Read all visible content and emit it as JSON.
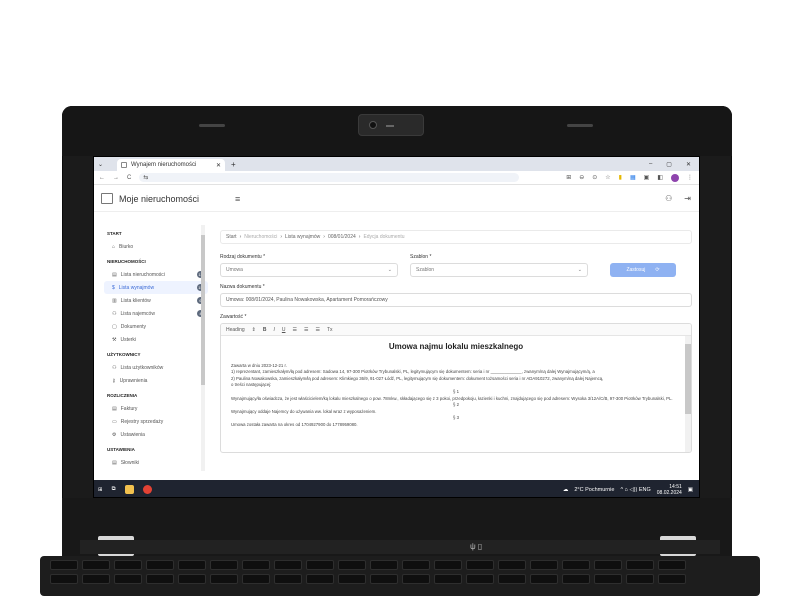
{
  "browser": {
    "tab_title": "Wynajem nieruchomości",
    "tab_close": "✕",
    "new_tab": "+",
    "window_controls": [
      "–",
      "▢",
      "✕"
    ],
    "nav": [
      "←",
      "→",
      "C",
      "⇆"
    ]
  },
  "app": {
    "title": "Moje nieruchomości",
    "menu_icon": "≡",
    "user_icon": "person-icon",
    "logout_icon": "logout-icon"
  },
  "sidebar": {
    "sections": [
      {
        "title": "START",
        "items": [
          {
            "label": "Biurko"
          }
        ]
      },
      {
        "title": "NIERUCHOMOŚCI",
        "items": [
          {
            "label": "Lista nieruchomości",
            "badge": "11"
          },
          {
            "label": "Lista wynajmów",
            "badge": "15",
            "active": true
          },
          {
            "label": "Lista klientów",
            "badge": "6"
          },
          {
            "label": "Lista najemców",
            "badge": "4"
          },
          {
            "label": "Dokumenty"
          },
          {
            "label": "Usterki"
          }
        ]
      },
      {
        "title": "UŻYTKOWNICY",
        "items": [
          {
            "label": "Lista użytkowników"
          },
          {
            "label": "Uprawnienia"
          }
        ]
      },
      {
        "title": "ROZLICZENIA",
        "items": [
          {
            "label": "Faktury"
          },
          {
            "label": "Rejestry sprzedaży"
          },
          {
            "label": "Ustawienia"
          }
        ]
      },
      {
        "title": "USTAWIENIA",
        "items": [
          {
            "label": "Słowniki"
          }
        ]
      }
    ]
  },
  "breadcrumb": [
    "Start",
    "Nieruchomości",
    "Lista wynajmów",
    "008/01/2024",
    "Edycja dokumentu"
  ],
  "form": {
    "doc_type_label": "Rodzaj dokumentu *",
    "doc_type_value": "Umowa",
    "template_label": "Szablon *",
    "template_value": "Szablon",
    "apply_button": "Zastosuj",
    "name_label": "Nazwa dokumentu *",
    "name_value": "Umowa: 008/01/2024, Paulina Nowakowska, Apartament Pomorańczowy",
    "content_label": "Zawartość *",
    "toolbar_heading": "Heading",
    "toolbar_buttons": [
      "B",
      "I",
      "U",
      "☰",
      "☰",
      "☰",
      "Tx"
    ]
  },
  "document": {
    "heading": "Umowa najmu lokalu mieszkalnego",
    "lines": [
      "Zawarta w dniu 2023-12-21 r.",
      "1) reprezentant, zamieszkałym/łą pod adresem: Sadowa 14, 97-300 Piotrków Trybunalski, PL, legitymującym się dokumentem: seria i nr _____________, zwanym/ną dalej Wynajmującym/ą, a",
      "2) Paulina Nowakowska, zamieszkałym/łą pod adresem: Klimkiego 36/9, 91-027 Łódź, PL, legitymującym się dokumentem: dokument tożsamości seria i nr ADA910272, zwanym/ną dalej Najemcą,",
      "o treści następującej:",
      "§ 1",
      "Wynajmujący/ła oświadcza, że jest właścicielem/ką lokalu mieszkalnego o pow. 78mkw., składającego się z 3 pokoi, przedpokoju, łazienki i kuchni, znajdującego się pod adresem: Wysoka 3/12A/C/B, 97-300 Piotrków Trybunalski, PL.",
      "§ 2",
      "Wynajmujący oddaje Najemcy do używania ww. lokal wraz z wyposażeniem.",
      "§ 3",
      "Umowa została zawarta na okres od 1704927900 do 1778959080."
    ]
  },
  "taskbar": {
    "weather": "2°C  Pochmurnie",
    "time": "14:51",
    "date": "08.02.2024",
    "tray": "^  ⌂  ◁))  ENG"
  },
  "colors": {
    "accent": "#3b6ad6",
    "button": "#8fb2f2",
    "taskbar": "#1f2430"
  }
}
